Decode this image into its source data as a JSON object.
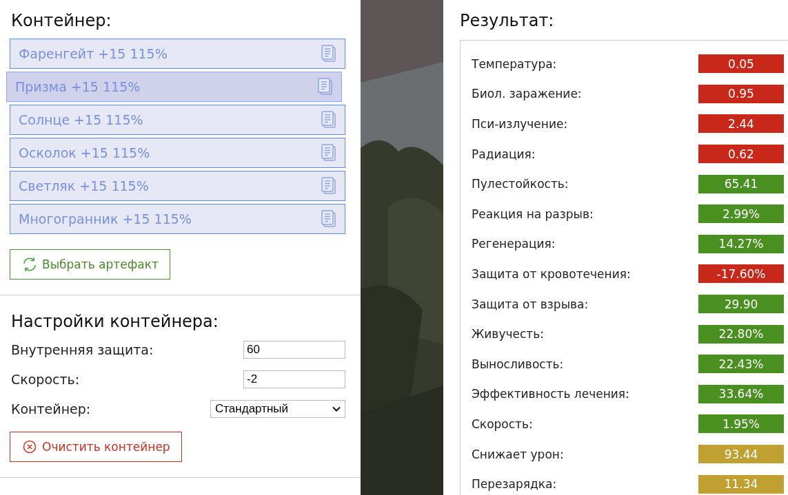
{
  "container": {
    "title": "Контейнер:",
    "artifacts": [
      {
        "label": "Фаренгейт +15 115%",
        "selected": false
      },
      {
        "label": "Призма +15 115%",
        "selected": true
      },
      {
        "label": "Солнце +15 115%",
        "selected": false
      },
      {
        "label": "Осколок +15 115%",
        "selected": false
      },
      {
        "label": "Светляк +15 115%",
        "selected": false
      },
      {
        "label": "Многогранник +15 115%",
        "selected": false
      }
    ],
    "choose_button": "Выбрать артефакт"
  },
  "settings": {
    "title": "Настройки контейнера:",
    "fields": [
      {
        "kind": "input",
        "label": "Внутренняя защита:",
        "value": "60"
      },
      {
        "kind": "input",
        "label": "Скорость:",
        "value": "-2"
      },
      {
        "kind": "select",
        "label": "Контейнер:",
        "value": "Стандартный"
      }
    ],
    "clear_button": "Очистить контейнер"
  },
  "result": {
    "title": "Результат:",
    "rows": [
      {
        "label": "Температура:",
        "value": "0.05",
        "color": "#c8281a"
      },
      {
        "label": "Биол. заражение:",
        "value": "0.95",
        "color": "#c8281a"
      },
      {
        "label": "Пси-излучение:",
        "value": "2.44",
        "color": "#c8281a"
      },
      {
        "label": "Радиация:",
        "value": "0.62",
        "color": "#c8281a"
      },
      {
        "label": "Пулестойкость:",
        "value": "65.41",
        "color": "#4a9020"
      },
      {
        "label": "Реакция на разрыв:",
        "value": "2.99%",
        "color": "#4a9020"
      },
      {
        "label": "Регенерация:",
        "value": "14.27%",
        "color": "#4a9020"
      },
      {
        "label": "Защита от кровотечения:",
        "value": "-17.60%",
        "color": "#c8281a"
      },
      {
        "label": "Защита от взрыва:",
        "value": "29.90",
        "color": "#4a9020"
      },
      {
        "label": "Живучесть:",
        "value": "22.80%",
        "color": "#4a9020"
      },
      {
        "label": "Выносливость:",
        "value": "22.43%",
        "color": "#4a9020"
      },
      {
        "label": "Эффективность лечения:",
        "value": "33.64%",
        "color": "#4a9020"
      },
      {
        "label": "Скорость:",
        "value": "1.95%",
        "color": "#4a9020"
      },
      {
        "label": "Снижает урон:",
        "value": "93.44",
        "color": "#c0a030"
      },
      {
        "label": "Перезарядка:",
        "value": "11.34",
        "color": "#c0a030"
      }
    ]
  }
}
